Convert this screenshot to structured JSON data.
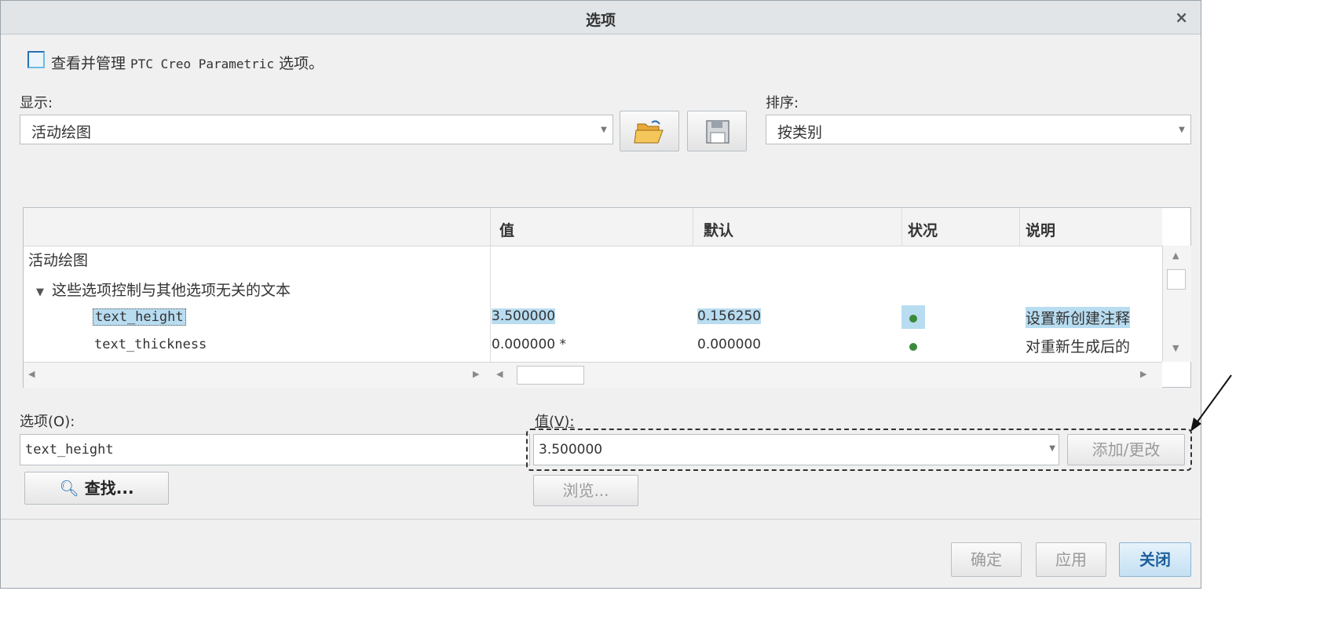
{
  "dialog": {
    "title": "选项",
    "close": "×"
  },
  "header": {
    "intro_prefix": "查看并管理 ",
    "intro_product": "PTC Creo Parametric",
    "intro_suffix": " 选项。"
  },
  "display": {
    "label": "显示:",
    "value": "活动绘图"
  },
  "sort": {
    "label": "排序:",
    "value": "按类别"
  },
  "table": {
    "columns": [
      "值",
      "默认",
      "状况",
      "说明"
    ],
    "group": "活动绘图",
    "section": "这些选项控制与其他选项无关的文本",
    "rows": [
      {
        "name": "text_height",
        "value": "3.500000",
        "default": "0.156250",
        "status": "ok",
        "description": "设置新创建注释",
        "selected": true
      },
      {
        "name": "text_thickness",
        "value": "0.000000 *",
        "default": "0.000000",
        "status": "ok",
        "description": "对重新生成后的",
        "selected": false
      }
    ],
    "status_color": "#3a8a3a",
    "highlight_color": "#b8dcf0"
  },
  "option_field": {
    "label": "选项(O):",
    "value": "text_height"
  },
  "value_field": {
    "label": "值(V):",
    "value": "3.500000"
  },
  "buttons": {
    "find": "查找...",
    "browse": "浏览...",
    "add_change": "添加/更改",
    "ok": "确定",
    "apply": "应用",
    "close": "关闭"
  },
  "colors": {
    "accent": "#2a6fb0",
    "close_button_bg": "#cfe6f5"
  }
}
